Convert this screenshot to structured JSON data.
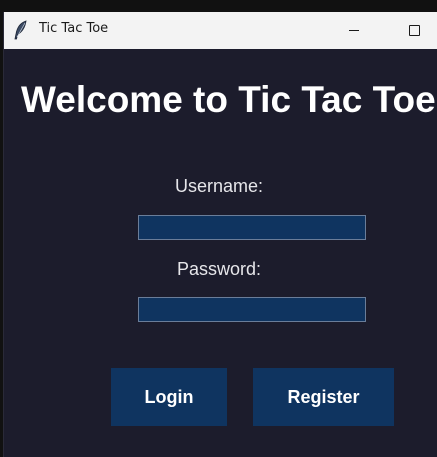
{
  "window": {
    "title": "Tic Tac Toe",
    "icon": "feather-icon",
    "controls": [
      "minimize-icon",
      "maximize-icon"
    ]
  },
  "login": {
    "heading": "Welcome to Tic Tac Toe",
    "username_label": "Username:",
    "username_value": "",
    "password_label": "Password:",
    "password_value": "",
    "login_button": "Login",
    "register_button": "Register"
  },
  "colors": {
    "background": "#1c1c2c",
    "accent": "#0f3460",
    "text": "#ffffff"
  }
}
